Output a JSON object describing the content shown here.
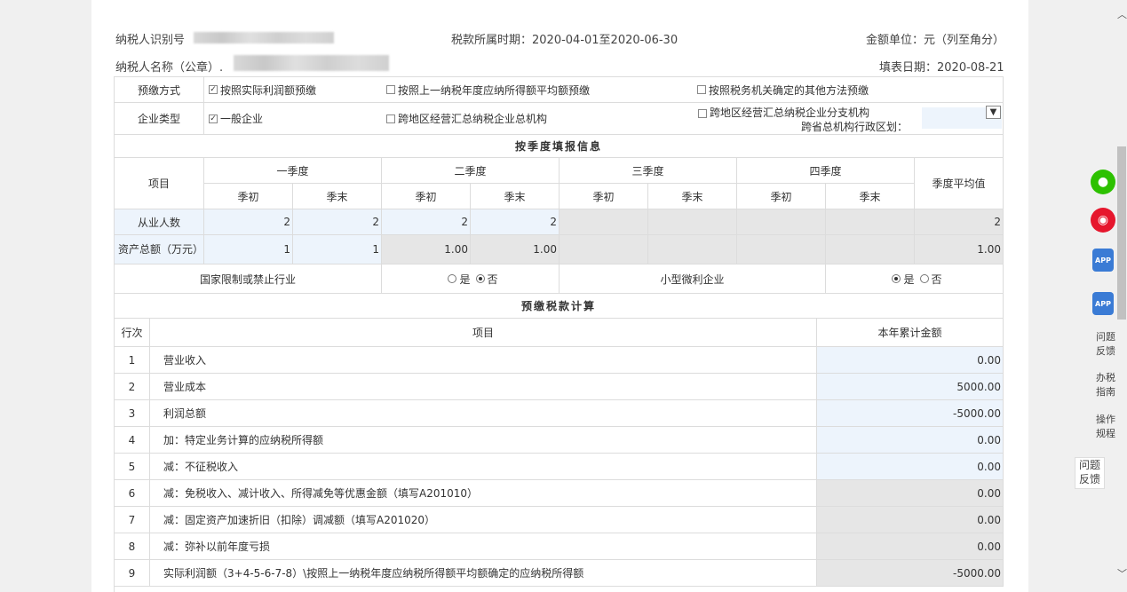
{
  "header": {
    "taxpayer_id_label": "纳税人识别号",
    "taxpayer_name_label": "纳税人名称（公章）.",
    "tax_period": "税款所属时期：2020-04-01至2020-06-30",
    "amount_unit": "金额单位：元（列至角分）",
    "fill_date": "填表日期：2020-08-21"
  },
  "prepay_method": {
    "label": "预缴方式",
    "options": [
      "按照实际利润额预缴",
      "按照上一纳税年度应纳所得额平均额预缴",
      "按照税务机关确定的其他方法预缴"
    ],
    "checked": [
      true,
      false,
      false
    ]
  },
  "enterprise_type": {
    "label": "企业类型",
    "options": [
      "一般企业",
      "跨地区经营汇总纳税企业总机构",
      "跨地区经营汇总纳税企业分支机构"
    ],
    "checked": [
      true,
      false,
      false
    ],
    "region_label": "跨省总机构行政区划：",
    "dropdown_icon": "chevron-down-icon"
  },
  "quarterly": {
    "section_title": "按季度填报信息",
    "item_header": "项目",
    "quarters": [
      "一季度",
      "二季度",
      "三季度",
      "四季度"
    ],
    "avg_header": "季度平均值",
    "sub_headers": [
      "季初",
      "季末",
      "季初",
      "季末",
      "季初",
      "季末",
      "季初",
      "季末"
    ],
    "rows": [
      {
        "label": "从业人数",
        "values": [
          "2",
          "2",
          "2",
          "2",
          "",
          "",
          "",
          ""
        ],
        "avg": "2"
      },
      {
        "label": "资产总额（万元）",
        "values": [
          "1",
          "1",
          "1.00",
          "1.00",
          "",
          "",
          "",
          ""
        ],
        "avg": "1.00"
      }
    ]
  },
  "restricted": {
    "label": "国家限制或禁止行业",
    "yes": "是",
    "no": "否",
    "selected": "否",
    "micro_label": "小型微利企业",
    "micro_selected": "是"
  },
  "calc": {
    "section_title": "预缴税款计算",
    "headers": {
      "row": "行次",
      "item": "项目",
      "amount": "本年累计金额"
    },
    "rows": [
      {
        "no": "1",
        "item": "营业收入",
        "amount": "0.00",
        "style": "blue"
      },
      {
        "no": "2",
        "item": "营业成本",
        "amount": "5000.00",
        "style": "blue"
      },
      {
        "no": "3",
        "item": "利润总额",
        "amount": "-5000.00",
        "style": "blue"
      },
      {
        "no": "4",
        "item": "加：特定业务计算的应纳税所得额",
        "amount": "0.00",
        "style": "blue"
      },
      {
        "no": "5",
        "item": "减：不征税收入",
        "amount": "0.00",
        "style": "blue"
      },
      {
        "no": "6",
        "item": "减：免税收入、减计收入、所得减免等优惠金额（填写A201010）",
        "amount": "0.00",
        "style": "gray"
      },
      {
        "no": "7",
        "item": "减：固定资产加速折旧（扣除）调减额（填写A201020）",
        "amount": "0.00",
        "style": "gray"
      },
      {
        "no": "8",
        "item": "减：弥补以前年度亏损",
        "amount": "0.00",
        "style": "gray"
      },
      {
        "no": "9",
        "item": "实际利润额（3+4-5-6-7-8）\\按照上一纳税年度应纳税所得额平均额确定的应纳税所得额",
        "amount": "-5000.00",
        "style": "gray"
      }
    ]
  },
  "sidebar": {
    "wechat_icon": "wechat-icon",
    "weibo_icon": "weibo-icon",
    "app_label": "APP",
    "items": [
      "问题反馈",
      "办税指南",
      "操作规程"
    ],
    "floating": "问题反馈"
  },
  "colors": {
    "input_blue": "#edf4fc",
    "readonly_gray": "#e6e6e6",
    "wechat": "#2dc100",
    "weibo": "#e6162d",
    "app": "#3a7bd5"
  }
}
